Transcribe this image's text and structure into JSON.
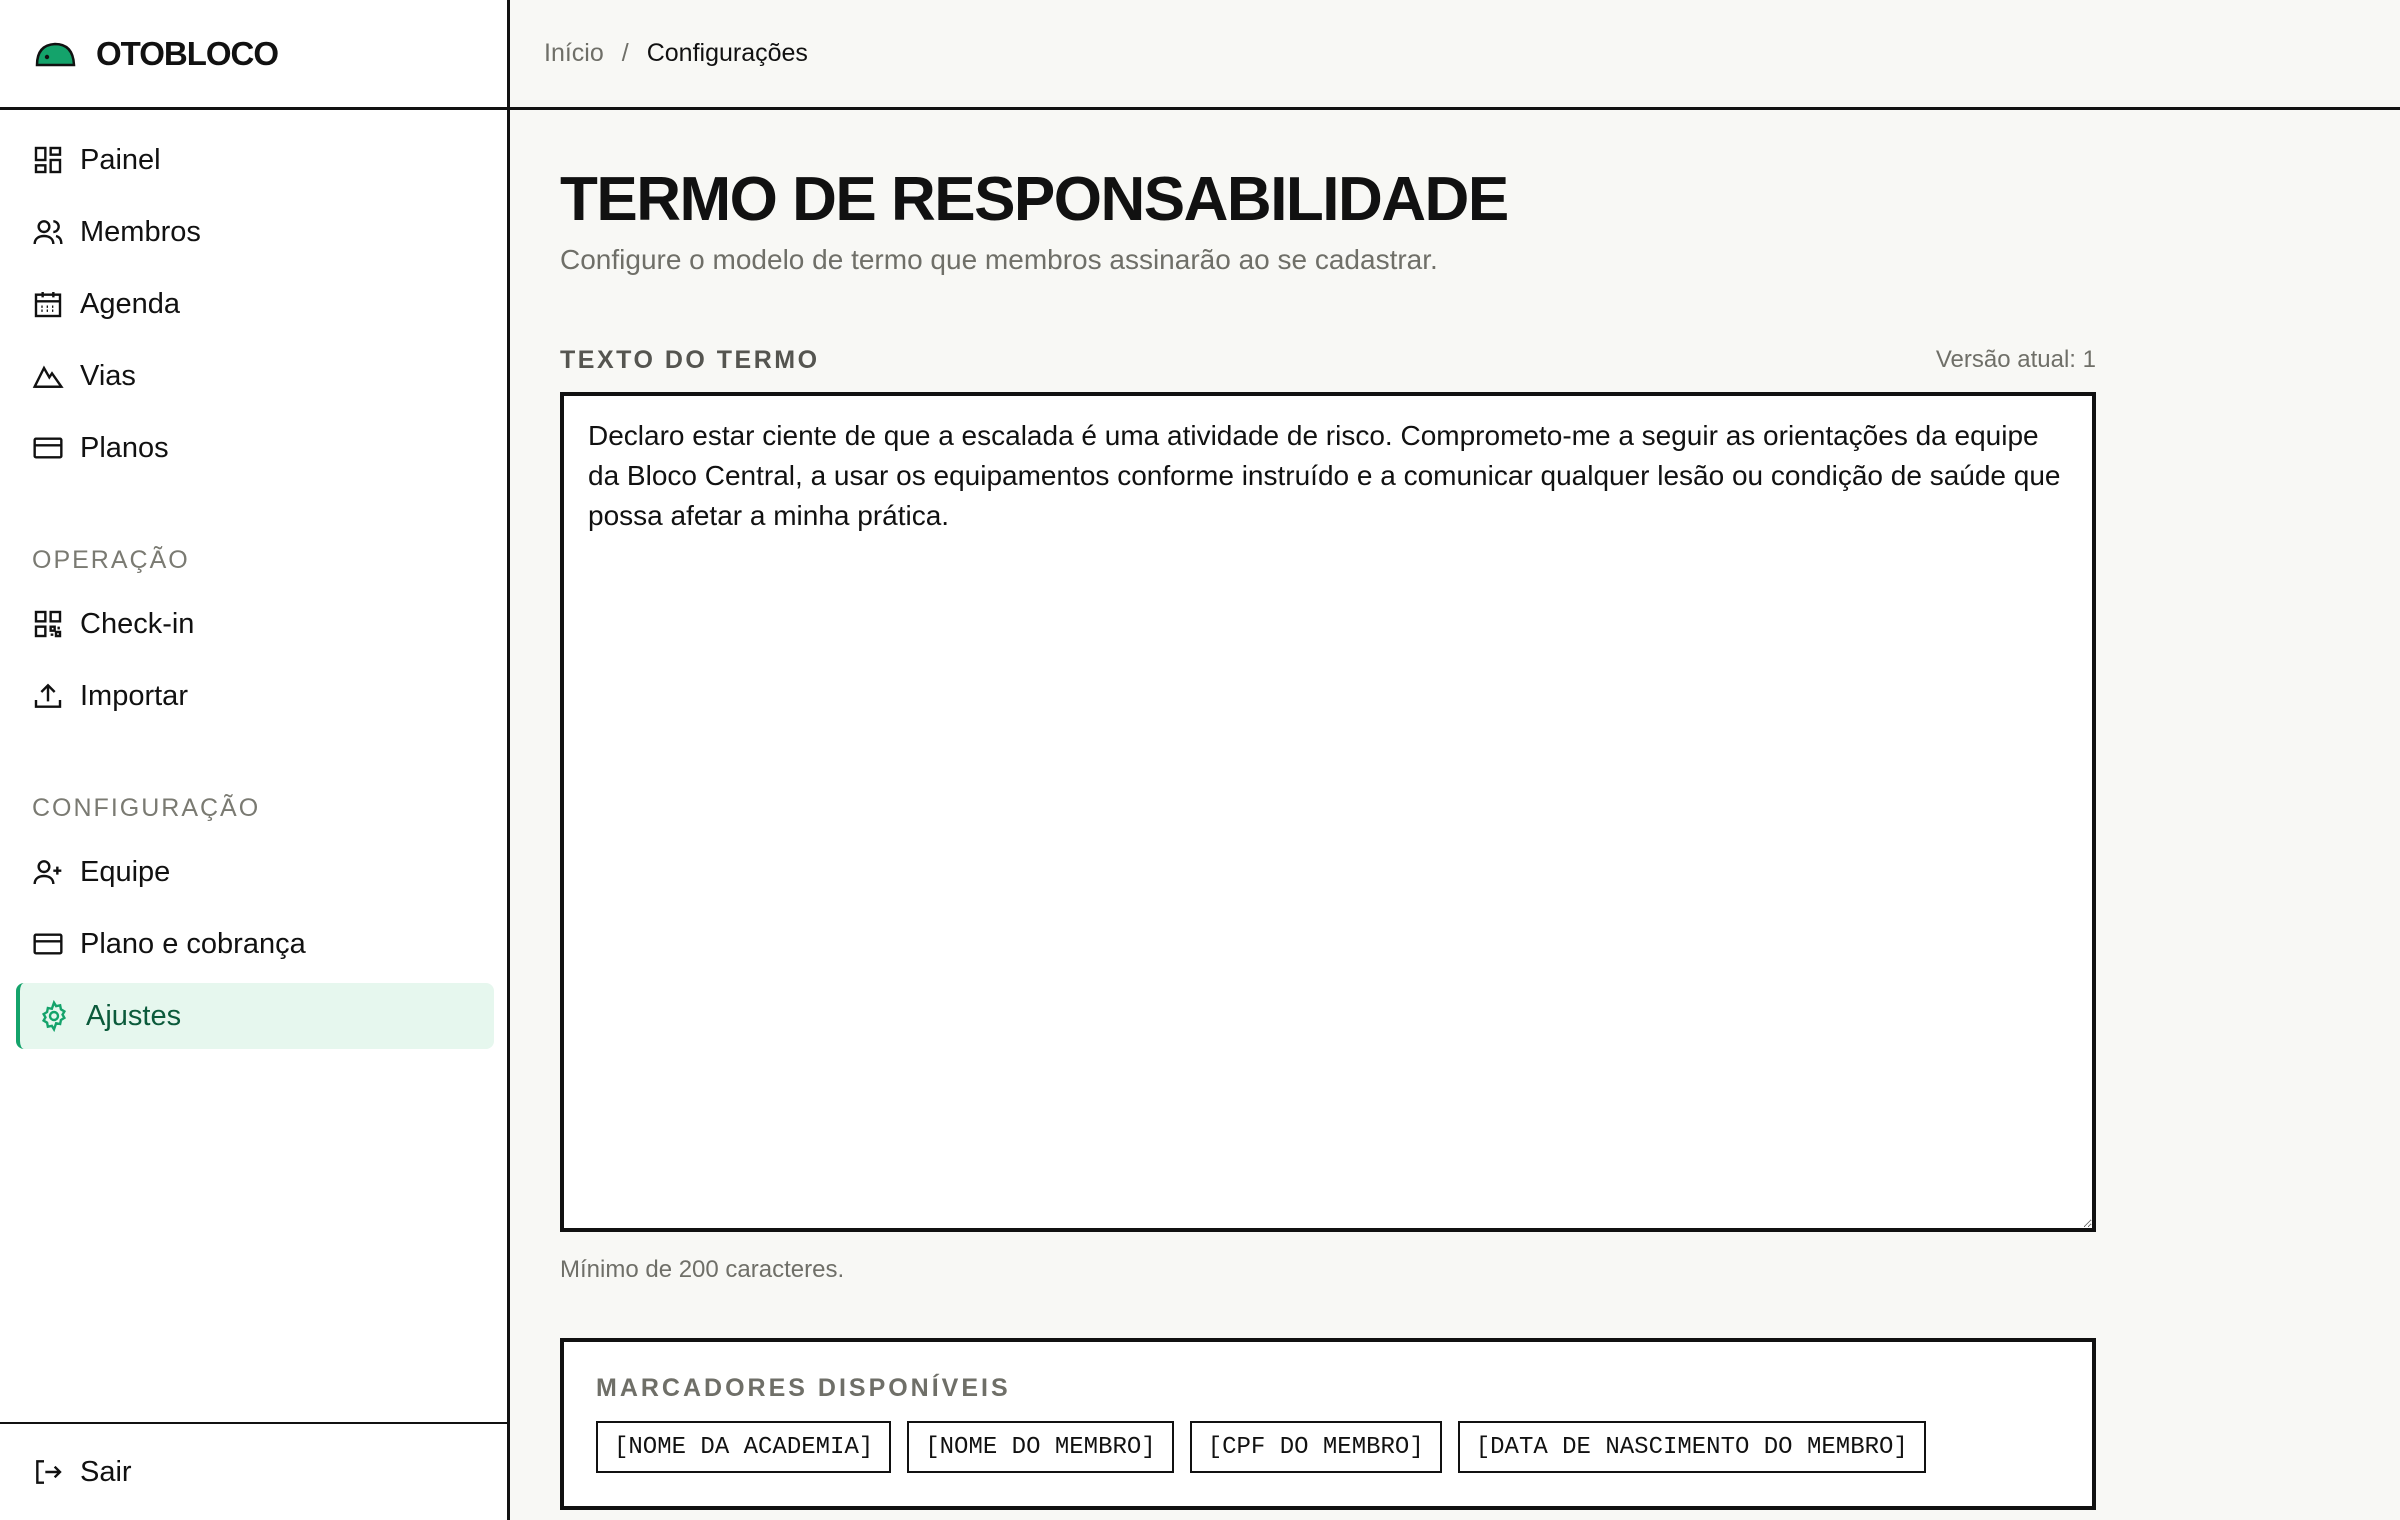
{
  "app": {
    "name": "OTOBLOCO",
    "accent": "#14a36b"
  },
  "breadcrumb": {
    "home": "Início",
    "separator": "/",
    "current": "Configurações"
  },
  "sidebar": {
    "items": [
      {
        "label": "Painel",
        "icon": "dashboard-icon"
      },
      {
        "label": "Membros",
        "icon": "users-icon"
      },
      {
        "label": "Agenda",
        "icon": "calendar-icon"
      },
      {
        "label": "Vias",
        "icon": "mountain-icon"
      },
      {
        "label": "Planos",
        "icon": "card-icon"
      }
    ],
    "operation_title": "OPERAÇÃO",
    "operation_items": [
      {
        "label": "Check-in",
        "icon": "qr-code-icon"
      },
      {
        "label": "Importar",
        "icon": "upload-icon"
      }
    ],
    "config_title": "CONFIGURAÇÃO",
    "config_items": [
      {
        "label": "Equipe",
        "icon": "user-plus-icon"
      },
      {
        "label": "Plano e cobrança",
        "icon": "card-icon"
      },
      {
        "label": "Ajustes",
        "icon": "gear-icon",
        "active": true
      }
    ],
    "logout_label": "Sair"
  },
  "main": {
    "title": "TERMO DE RESPONSABILIDADE",
    "subtitle": "Configure o modelo de termo que membros assinarão ao se cadastrar.",
    "field_label": "TEXTO DO TERMO",
    "version": "Versão atual: 1",
    "term_text": "Declaro estar ciente de que a escalada é uma atividade de risco. Comprometo-me a seguir as orientações da equipe da Bloco Central, a usar os equipamentos conforme instruído e a comunicar qualquer lesão ou condição de saúde que possa afetar a minha prática.",
    "hint": "Mínimo de 200 caracteres.",
    "markers_title": "MARCADORES DISPONÍVEIS",
    "markers": [
      "[NOME DA ACADEMIA]",
      "[NOME DO MEMBRO]",
      "[CPF DO MEMBRO]",
      "[DATA DE NASCIMENTO DO MEMBRO]"
    ]
  }
}
